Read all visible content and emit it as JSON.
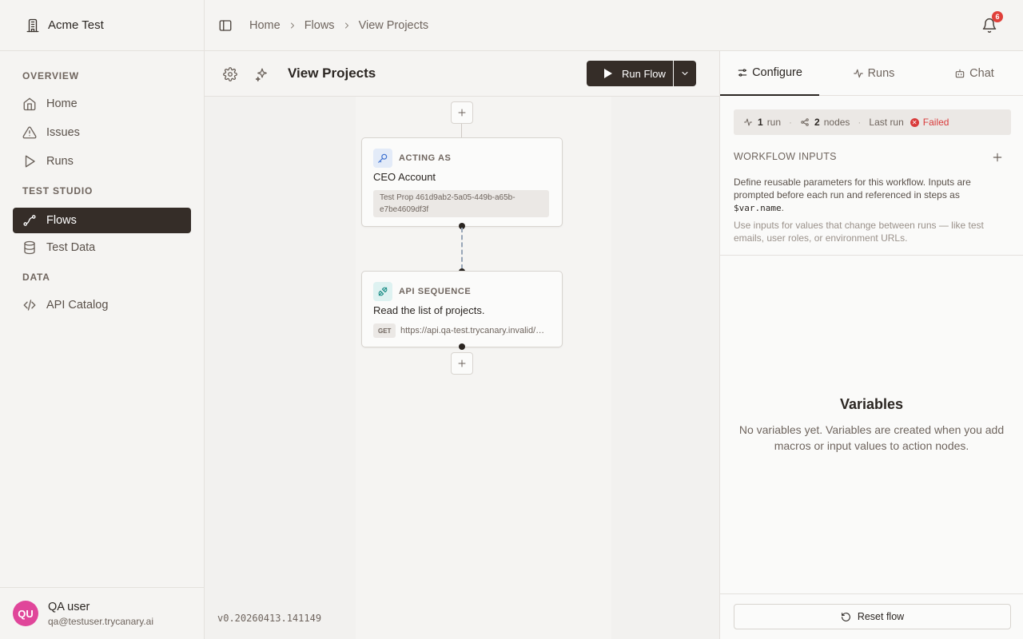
{
  "org": {
    "name": "Acme Test",
    "icon": "building-icon"
  },
  "sidebar": {
    "sections": [
      {
        "title": "OVERVIEW"
      },
      {
        "title": "TEST STUDIO"
      },
      {
        "title": "DATA"
      }
    ],
    "items": [
      {
        "label": "Home",
        "icon": "home-icon"
      },
      {
        "label": "Issues",
        "icon": "warning-icon"
      },
      {
        "label": "Runs",
        "icon": "play-icon"
      },
      {
        "label": "Flows",
        "icon": "flow-icon",
        "active": true
      },
      {
        "label": "Test Data",
        "icon": "database-icon"
      },
      {
        "label": "API Catalog",
        "icon": "code-icon"
      }
    ]
  },
  "user": {
    "initials": "QU",
    "name": "QA user",
    "email": "qa@testuser.trycanary.ai",
    "avatar_color": "#e0469a"
  },
  "breadcrumb": [
    "Home",
    "Flows",
    "View Projects"
  ],
  "notifications": {
    "count": "6"
  },
  "flow": {
    "title": "View Projects",
    "run_label": "Run Flow",
    "nodes": [
      {
        "type_label": "ACTING AS",
        "title": "CEO Account",
        "detail": "Test Prop 461d9ab2-5a05-449b-a65b-e7be4609df3f",
        "icon": "key-icon"
      },
      {
        "type_label": "API SEQUENCE",
        "title": "Read the list of projects.",
        "method": "GET",
        "url": "https://api.qa-test.trycanary.invalid/users/me/projects",
        "icon": "plug-icon"
      }
    ]
  },
  "version": "v0.20260413.141149",
  "panel": {
    "tabs": [
      {
        "label": "Configure",
        "icon": "sliders-icon",
        "active": true
      },
      {
        "label": "Runs",
        "icon": "activity-icon"
      },
      {
        "label": "Chat",
        "icon": "bot-icon"
      }
    ],
    "stats": {
      "runs_count": "1",
      "runs_label": "run",
      "nodes_count": "2",
      "nodes_label": "nodes",
      "last_run_label": "Last run",
      "last_run_status": "Failed"
    },
    "workflow_inputs": {
      "title": "WORKFLOW INPUTS",
      "description": "Define reusable parameters for this workflow. Inputs are prompted before each run and referenced in steps as",
      "code": "$var.name",
      "code_suffix": ".",
      "hint": "Use inputs for values that change between runs — like test emails, user roles, or environment URLs."
    },
    "variables": {
      "title": "Variables",
      "description": "No variables yet. Variables are created when you add macros or input values to action nodes."
    },
    "reset_label": "Reset flow"
  },
  "colors": {
    "primary": "#352d28",
    "danger": "#d93b3b",
    "badge": "#e0403a",
    "avatar": "#e0469a"
  }
}
